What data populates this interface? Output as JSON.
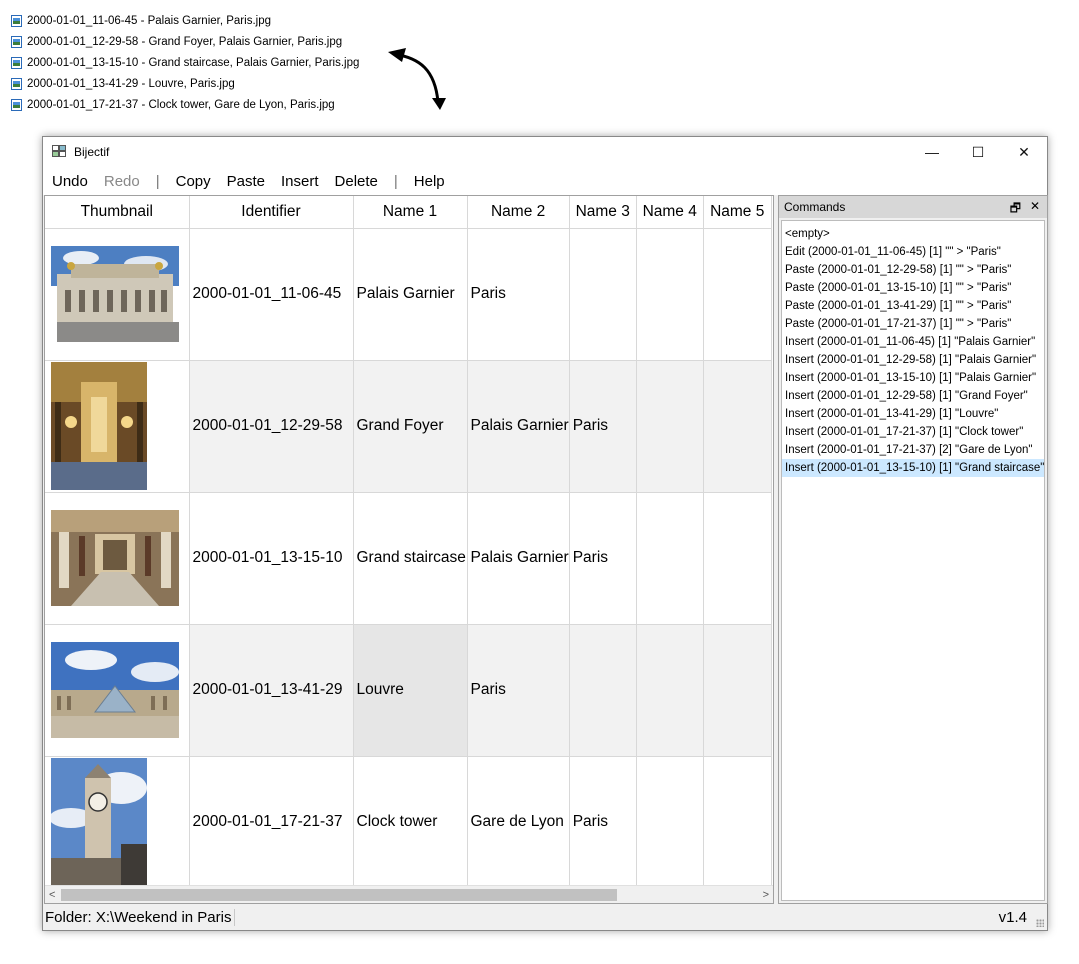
{
  "files": [
    "2000-01-01_11-06-45 - Palais Garnier, Paris.jpg",
    "2000-01-01_12-29-58 - Grand Foyer, Palais Garnier, Paris.jpg",
    "2000-01-01_13-15-10 - Grand staircase, Palais Garnier, Paris.jpg",
    "2000-01-01_13-41-29 - Louvre, Paris.jpg",
    "2000-01-01_17-21-37 - Clock tower, Gare de Lyon, Paris.jpg"
  ],
  "window": {
    "title": "Bijectif",
    "minimize": "—",
    "maximize": "☐",
    "close": "✕"
  },
  "menu": {
    "undo": "Undo",
    "redo": "Redo",
    "sep": "|",
    "copy": "Copy",
    "paste": "Paste",
    "insert": "Insert",
    "delete": "Delete",
    "help": "Help"
  },
  "grid": {
    "columns": [
      "Thumbnail",
      "Identifier",
      "Name 1",
      "Name 2",
      "Name 3",
      "Name 4",
      "Name 5"
    ],
    "rows": [
      {
        "id": "2000-01-01_11-06-45",
        "n1": "Palais Garnier",
        "n2": "Paris",
        "n3": "",
        "n4": "",
        "n5": ""
      },
      {
        "id": "2000-01-01_12-29-58",
        "n1": "Grand Foyer",
        "n2": "Palais Garnier",
        "n3": "Paris",
        "n4": "",
        "n5": ""
      },
      {
        "id": "2000-01-01_13-15-10",
        "n1": "Grand staircase",
        "n2": "Palais Garnier",
        "n3": "Paris",
        "n4": "",
        "n5": ""
      },
      {
        "id": "2000-01-01_13-41-29",
        "n1": "Louvre",
        "n2": "Paris",
        "n3": "",
        "n4": "",
        "n5": ""
      },
      {
        "id": "2000-01-01_17-21-37",
        "n1": "Clock tower",
        "n2": "Gare de Lyon",
        "n3": "Paris",
        "n4": "",
        "n5": ""
      }
    ],
    "scroll_left": "<",
    "scroll_right": ">"
  },
  "commands": {
    "title": "Commands",
    "float": "🗗",
    "close": "✕",
    "items": [
      "<empty>",
      "Edit (2000-01-01_11-06-45) [1] \"\" > \"Paris\"",
      "Paste (2000-01-01_12-29-58) [1] \"\" > \"Paris\"",
      "Paste (2000-01-01_13-15-10) [1] \"\" > \"Paris\"",
      "Paste (2000-01-01_13-41-29) [1] \"\" > \"Paris\"",
      "Paste (2000-01-01_17-21-37) [1] \"\" > \"Paris\"",
      "Insert (2000-01-01_11-06-45) [1] \"Palais Garnier\"",
      "Insert (2000-01-01_12-29-58) [1] \"Palais Garnier\"",
      "Insert (2000-01-01_13-15-10) [1] \"Palais Garnier\"",
      "Insert (2000-01-01_12-29-58) [1] \"Grand Foyer\"",
      "Insert (2000-01-01_13-41-29) [1] \"Louvre\"",
      "Insert (2000-01-01_17-21-37) [1] \"Clock tower\"",
      "Insert (2000-01-01_17-21-37) [2] \"Gare de Lyon\"",
      "Insert (2000-01-01_13-15-10) [1] \"Grand staircase\""
    ]
  },
  "status": {
    "folder": "Folder: X:\\Weekend in Paris",
    "version": "v1.4"
  }
}
